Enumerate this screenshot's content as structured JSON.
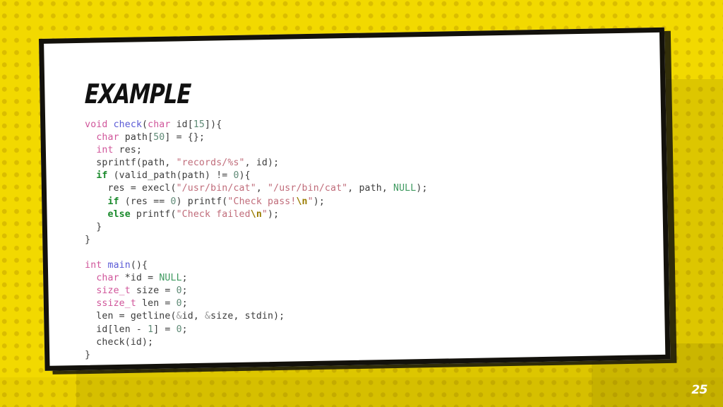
{
  "slide": {
    "title": "EXAMPLE",
    "page_number": "25",
    "theme": {
      "background_color": "#f2d900",
      "dot_color": "#d9bc00",
      "card_background": "#ffffff",
      "card_border_color": "#13110b",
      "title_color": "#111111",
      "page_number_color": "#ffffff"
    }
  },
  "code": {
    "language": "c",
    "raw": "void check(char id[15]){\n  char path[50] = {};\n  int res;\n  sprintf(path, \"records/%s\", id);\n  if (valid_path(path) != 0){\n    res = execl(\"/usr/bin/cat\", \"/usr/bin/cat\", path, NULL);\n    if (res == 0) printf(\"Check pass!\\n\");\n    else printf(\"Check failed\\n\");\n  }\n}\n\nint main(){\n  char *id = NULL;\n  size_t size = 0;\n  ssize_t len = 0;\n  len = getline(&id, &size, stdin);\n  id[len - 1] = 0;\n  check(id);\n}",
    "lines": [
      "void check(char id[15]){",
      "  char path[50] = {};",
      "  int res;",
      "  sprintf(path, \"records/%s\", id);",
      "  if (valid_path(path) != 0){",
      "    res = execl(\"/usr/bin/cat\", \"/usr/bin/cat\", path, NULL);",
      "    if (res == 0) printf(\"Check pass!\\n\");",
      "    else printf(\"Check failed\\n\");",
      "  }",
      "}",
      "",
      "int main(){",
      "  char *id = NULL;",
      "  size_t size = 0;",
      "  ssize_t len = 0;",
      "  len = getline(&id, &size, stdin);",
      "  id[len - 1] = 0;",
      "  check(id);",
      "}"
    ],
    "tokens": {
      "void": "void",
      "check": "check",
      "char": "char",
      "int": "int",
      "if": "if",
      "else": "else",
      "size_t": "size_t",
      "ssize_t": "ssize_t",
      "null": "NULL",
      "str_records": "\"records/%s\"",
      "str_usrbincat": "\"/usr/bin/cat\"",
      "str_check_pass": "\"Check pass!\\n\"",
      "str_check_failed": "\"Check failed\\n\"",
      "escape": "\\n"
    },
    "syntax_colors": {
      "type_keyword": "#d0559a",
      "control_keyword": "#1a8a2c",
      "function_name": "#5a5ad6",
      "string": "#c06c7a",
      "escape": "#9a7c00",
      "number": "#5f8a76",
      "constant": "#3f9a60",
      "ampersand": "#9c9c9c",
      "plain": "#3c3c3c"
    }
  }
}
